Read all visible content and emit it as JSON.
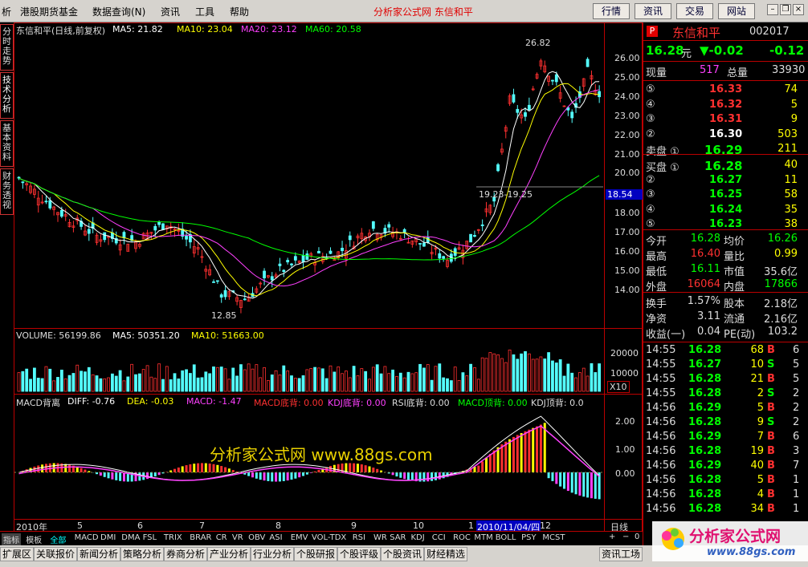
{
  "menu": {
    "items": [
      "析",
      "港股期货基金",
      "数据查询(N)",
      "资讯",
      "工具",
      "帮助"
    ],
    "title": "分析家公式网 东信和平",
    "buttons": [
      "行情",
      "资讯",
      "交易",
      "网站"
    ]
  },
  "left_tabs": [
    "分时走势",
    "技术分析",
    "基本资料",
    "财务透视"
  ],
  "main_chart": {
    "header": "东信和平(日线,前复权)",
    "ma5": "MA5: 21.82",
    "ma10": "MA10: 23.04",
    "ma20": "MA20: 23.12",
    "ma60": "MA60: 20.58",
    "high_label": "26.82",
    "low_label": "12.85",
    "range_label": "19.23-19.25",
    "cursor_price": "18.54",
    "y_ticks": [
      "26.00",
      "25.00",
      "24.00",
      "23.00",
      "22.00",
      "21.00",
      "20.00",
      "18.00",
      "17.00",
      "16.00",
      "15.00",
      "14.00"
    ],
    "colors": {
      "up": "#ff3030",
      "down": "#54ffff",
      "ma5": "#ffffff",
      "ma10": "#ffff00",
      "ma20": "#ff40ff",
      "ma60": "#00ff00"
    }
  },
  "volume_chart": {
    "header": "VOLUME: 56199.86",
    "ma5": "MA5: 50351.20",
    "ma10": "MA10: 51663.00",
    "y_ticks": [
      "20000",
      "10000"
    ],
    "unit": "X10"
  },
  "macd_chart": {
    "header": "MACD背离",
    "diff": "DIFF: -0.76",
    "dea": "DEA: -0.03",
    "macd": "MACD: -1.47",
    "macd_bottom": "MACD底背: 0.00",
    "kdj_bottom": "KDJ底背: 0.00",
    "rsi_bottom": "RSI底背: 0.00",
    "macd_top": "MACD顶背: 0.00",
    "kdj_top": "KDJ顶背: 0.0",
    "y_ticks": [
      "2.00",
      "1.00",
      "0.00"
    ],
    "watermark": "分析家公式网 www.88gs.com"
  },
  "x_axis": {
    "labels": [
      "2010年",
      "5",
      "6",
      "7",
      "8",
      "9",
      "10",
      "1",
      "2010/11/04/四",
      "12"
    ],
    "period": "日线"
  },
  "stock_panel": {
    "flag": "P",
    "name": "东信和平",
    "code": "002017",
    "price": "16.28",
    "unit": "元",
    "change": "▼-0.02",
    "change2": "-0.12",
    "vol_now_label": "现量",
    "vol_now": "517",
    "vol_total_label": "总量",
    "vol_total": "33930",
    "asks": [
      {
        "lvl": "⑤",
        "price": "16.33",
        "qty": "74"
      },
      {
        "lvl": "④",
        "price": "16.32",
        "qty": "5"
      },
      {
        "lvl": "③",
        "price": "16.31",
        "qty": "9"
      },
      {
        "lvl": "②",
        "price": "16.30",
        "qty": "503"
      },
      {
        "lvl": "卖盘 ①",
        "price": "16.29",
        "qty": "211"
      }
    ],
    "bids": [
      {
        "lvl": "买盘 ①",
        "price": "16.28",
        "qty": "40"
      },
      {
        "lvl": "②",
        "price": "16.27",
        "qty": "11"
      },
      {
        "lvl": "③",
        "price": "16.25",
        "qty": "58"
      },
      {
        "lvl": "④",
        "price": "16.24",
        "qty": "35"
      },
      {
        "lvl": "⑤",
        "price": "16.23",
        "qty": "38"
      }
    ],
    "stats": [
      {
        "l1": "今开",
        "v1": "16.28",
        "l2": "均价",
        "v2": "16.26"
      },
      {
        "l1": "最高",
        "v1": "16.40",
        "l2": "量比",
        "v2": "0.99"
      },
      {
        "l1": "最低",
        "v1": "16.11",
        "l2": "市值",
        "v2": "35.6亿"
      },
      {
        "l1": "外盘",
        "v1": "16064",
        "l2": "内盘",
        "v2": "17866"
      }
    ],
    "stats2": [
      {
        "l1": "换手",
        "v1": "1.57%",
        "l2": "股本",
        "v2": "2.18亿"
      },
      {
        "l1": "净资",
        "v1": "3.11",
        "l2": "流通",
        "v2": "2.16亿"
      },
      {
        "l1": "收益(一)",
        "v1": "0.04",
        "l2": "PE(动)",
        "v2": "103.2"
      }
    ],
    "ticks": [
      {
        "t": "14:55",
        "p": "16.28",
        "v": "68",
        "s": "B",
        "n": "6"
      },
      {
        "t": "14:55",
        "p": "16.27",
        "v": "10",
        "s": "S",
        "n": "5"
      },
      {
        "t": "14:55",
        "p": "16.28",
        "v": "21",
        "s": "B",
        "n": "5"
      },
      {
        "t": "14:55",
        "p": "16.28",
        "v": "2",
        "s": "S",
        "n": "2"
      },
      {
        "t": "14:56",
        "p": "16.29",
        "v": "5",
        "s": "B",
        "n": "2"
      },
      {
        "t": "14:56",
        "p": "16.28",
        "v": "9",
        "s": "S",
        "n": "2"
      },
      {
        "t": "14:56",
        "p": "16.29",
        "v": "7",
        "s": "B",
        "n": "6"
      },
      {
        "t": "14:56",
        "p": "16.28",
        "v": "19",
        "s": "B",
        "n": "3"
      },
      {
        "t": "14:56",
        "p": "16.29",
        "v": "40",
        "s": "B",
        "n": "7"
      },
      {
        "t": "14:56",
        "p": "16.28",
        "v": "5",
        "s": "B",
        "n": "1"
      },
      {
        "t": "14:56",
        "p": "16.28",
        "v": "4",
        "s": "B",
        "n": "1"
      },
      {
        "t": "14:56",
        "p": "16.28",
        "v": "34",
        "s": "B",
        "n": "1"
      }
    ]
  },
  "indicator_tabs": [
    "指标",
    "模板",
    "全部",
    "MACD",
    "DMI",
    "DMA",
    "FSL",
    "TRIX",
    "BRAR",
    "CR",
    "VR",
    "OBV",
    "ASI",
    "EMV",
    "VOL-TDX",
    "RSI",
    "WR",
    "SAR",
    "KDJ",
    "CCI",
    "ROC",
    "MTM",
    "BOLL",
    "PSY",
    "MCST"
  ],
  "nav_tabs": [
    "扩展区",
    "关联报价",
    "新闻分析",
    "策略分析",
    "券商分析",
    "产业分析",
    "行业分析",
    "个股研报",
    "个股评级",
    "个股资讯",
    "财经精选"
  ],
  "info_tab": "资讯工场",
  "logo": {
    "name": "分析家公式网",
    "url": "www.88gs.com"
  }
}
